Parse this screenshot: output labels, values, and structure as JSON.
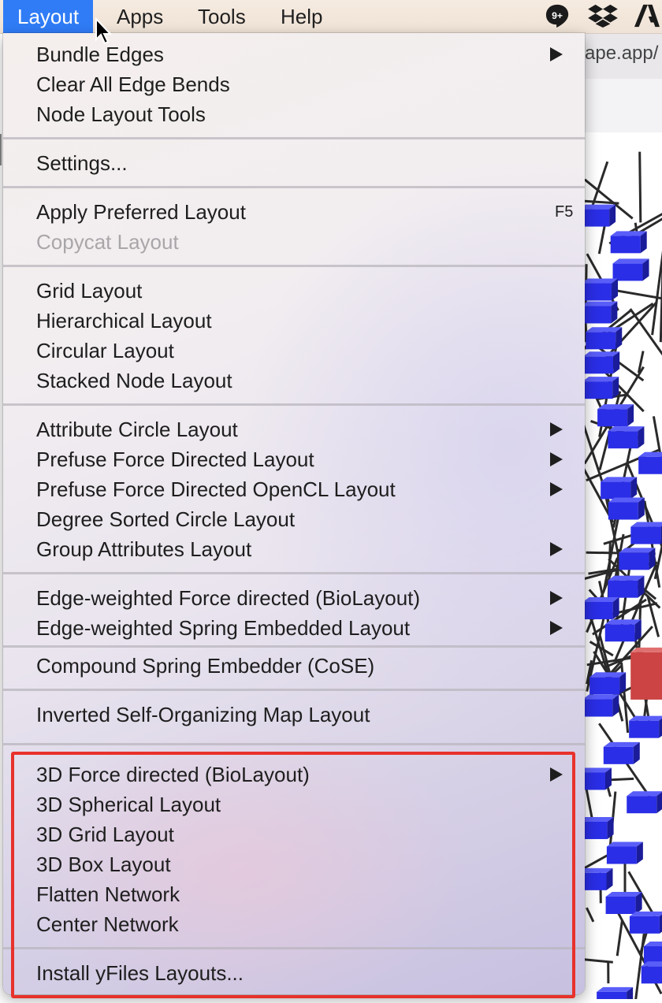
{
  "menubar": {
    "items": [
      "Layout",
      "Apps",
      "Tools",
      "Help"
    ],
    "active_index": 0,
    "status_icons": [
      "hangouts-icon",
      "dropbox-icon",
      "adobe-icon"
    ],
    "badge_text": "9+"
  },
  "background_window": {
    "url_fragment": "ape.app/"
  },
  "layout_menu": {
    "groups": [
      [
        {
          "label": "Bundle Edges",
          "submenu": true
        },
        {
          "label": "Clear All Edge Bends"
        },
        {
          "label": "Node Layout Tools"
        }
      ],
      [
        {
          "label": "Settings..."
        }
      ],
      [
        {
          "label": "Apply Preferred Layout",
          "shortcut": "F5"
        },
        {
          "label": "Copycat Layout",
          "disabled": true
        }
      ],
      [
        {
          "label": "Grid Layout"
        },
        {
          "label": "Hierarchical Layout"
        },
        {
          "label": "Circular Layout"
        },
        {
          "label": "Stacked Node Layout"
        }
      ],
      [
        {
          "label": "Attribute Circle Layout",
          "submenu": true
        },
        {
          "label": "Prefuse Force Directed Layout",
          "submenu": true
        },
        {
          "label": "Prefuse Force Directed OpenCL Layout",
          "submenu": true
        },
        {
          "label": "Degree Sorted Circle Layout"
        },
        {
          "label": "Group Attributes Layout",
          "submenu": true
        }
      ],
      [
        {
          "label": "Edge-weighted Force directed (BioLayout)",
          "submenu": true
        },
        {
          "label": "Edge-weighted Spring Embedded Layout",
          "submenu": true
        }
      ],
      [
        {
          "label": "Compound Spring Embedder (CoSE)"
        }
      ],
      [
        {
          "label": "Inverted Self-Organizing Map Layout"
        }
      ],
      [
        {
          "label": "3D Force directed (BioLayout)",
          "submenu": true
        },
        {
          "label": "3D Spherical Layout"
        },
        {
          "label": "3D Grid Layout"
        },
        {
          "label": "3D Box Layout"
        },
        {
          "label": "Flatten Network"
        },
        {
          "label": "Center Network"
        }
      ],
      [
        {
          "label": "Install yFiles Layouts..."
        }
      ]
    ]
  },
  "colors": {
    "menubar_active": "#2f7cf6",
    "highlight_box": "#e8312b",
    "network_node": "#2a2ee6",
    "network_node_selected": "#cc4444",
    "network_edge": "#2a2a2a"
  }
}
